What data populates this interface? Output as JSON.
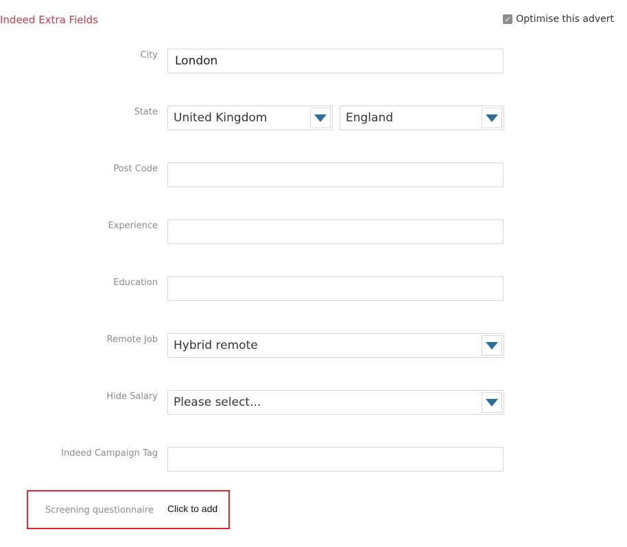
{
  "section": {
    "title": "Indeed Extra Fields"
  },
  "optimise": {
    "label": "Optimise this advert",
    "checked": true
  },
  "fields": {
    "city": {
      "label": "City",
      "value": "London"
    },
    "state": {
      "label": "State",
      "country": "United Kingdom",
      "region": "England"
    },
    "post_code": {
      "label": "Post Code",
      "value": ""
    },
    "experience": {
      "label": "Experience",
      "value": ""
    },
    "education": {
      "label": "Education",
      "value": ""
    },
    "remote_job": {
      "label": "Remote Job",
      "value": "Hybrid remote"
    },
    "hide_salary": {
      "label": "Hide Salary",
      "value": "Please select..."
    },
    "campaign_tag": {
      "label": "Indeed Campaign Tag",
      "value": ""
    }
  },
  "screening": {
    "label": "Screening questionnaire",
    "action": "Click to add"
  },
  "colors": {
    "title": "#c23a4a",
    "arrow": "#2a6f9a",
    "highlight": "#e0262a"
  }
}
